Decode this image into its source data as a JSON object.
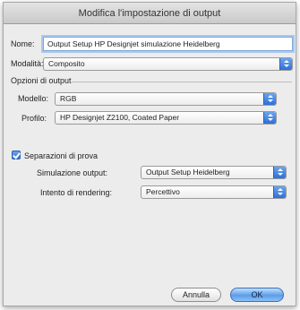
{
  "window": {
    "title": "Modifica l'impostazione di output"
  },
  "form": {
    "name_label": "Nome:",
    "name_value": "Output Setup HP Designjet simulazione Heidelberg",
    "mode_label": "Modalità:",
    "mode_value": "Composito",
    "output_options_heading": "Opzioni di output",
    "model_label": "Modello:",
    "model_value": "RGB",
    "profile_label": "Profilo:",
    "profile_value": "HP Designjet Z2100, Coated Paper",
    "proof_checkbox_label": "Separazioni di prova",
    "proof_checked": true,
    "simulation_label": "Simulazione output:",
    "simulation_value": "Output Setup Heidelberg",
    "intent_label": "Intento di rendering:",
    "intent_value": "Percettivo"
  },
  "buttons": {
    "cancel_label": "Annulla",
    "ok_label": "OK"
  },
  "colors": {
    "accent": "#3d7fe0",
    "window_bg": "#ececec"
  }
}
